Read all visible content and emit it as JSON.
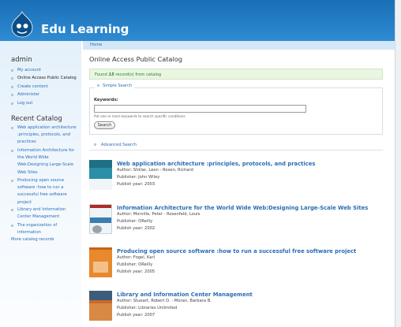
{
  "site": {
    "name": "Edu Learning",
    "logo": "drupal-drop-logo"
  },
  "sidebar": {
    "user_heading": "admin",
    "user_menu": [
      {
        "label": "My account",
        "active": false
      },
      {
        "label": "Online Access Public Catalog",
        "active": true
      },
      {
        "label": "Create content",
        "active": false
      },
      {
        "label": "Administer",
        "active": false
      },
      {
        "label": "Log out",
        "active": false
      }
    ],
    "recent_heading": "Recent Catalog",
    "recent_items": [
      {
        "lines": [
          "Web application architecture",
          ":principles, protocols, and",
          "practices"
        ]
      },
      {
        "lines": [
          "Information Architecture for",
          "the World Wide",
          "Web:Designing Large-Scale",
          "Web Sites"
        ]
      },
      {
        "lines": [
          "Producing open source",
          "software :how to run a",
          "successful free software",
          "project"
        ]
      },
      {
        "lines": [
          "Library and Information",
          "Center Management"
        ]
      },
      {
        "lines": [
          "The organization of",
          "information"
        ]
      }
    ],
    "more_link": "More catalog records"
  },
  "breadcrumb": "Home",
  "page_title": "Online Access Public Catalog",
  "status": {
    "prefix": "Found ",
    "count": "15",
    "suffix": " record(s) from catalog"
  },
  "simple_search": {
    "legend": "Simple Search",
    "keywords_label": "Keywords:",
    "keywords_value": "",
    "hint": "Put one or more keywords to search specific conditions",
    "button": "Search"
  },
  "advanced_search": "Advanced Search",
  "books": [
    {
      "title": "Web application architecture :principles, protocols, and practices",
      "author": "Author: Shklar, Leon - Rosen, Richard",
      "publisher": "Publisher: John Wiley",
      "year": "Publish year: 2003",
      "cover_color": "#2b8fa8"
    },
    {
      "title": "Information Architecture for the World Wide Web:Designing Large-Scale Web Sites",
      "author": "Author: Morville, Peter - Rosenfeld, Louis",
      "publisher": "Publisher: OReilly",
      "year": "Publish year: 2002",
      "cover_color": "#eef4f7"
    },
    {
      "title": "Producing open source software :how to run a successful free software project",
      "author": "Author: Fogel, Karl",
      "publisher": "Publisher: OReilly",
      "year": "Publish year: 2005",
      "cover_color": "#e8892e"
    },
    {
      "title": "Library and Information Center Management",
      "author": "Author: Stueart, Robert D. - Moran, Barbara B.",
      "publisher": "Publisher: Libraries Unlimited",
      "year": "Publish year: 2007",
      "cover_color": "#c96a2a"
    }
  ]
}
